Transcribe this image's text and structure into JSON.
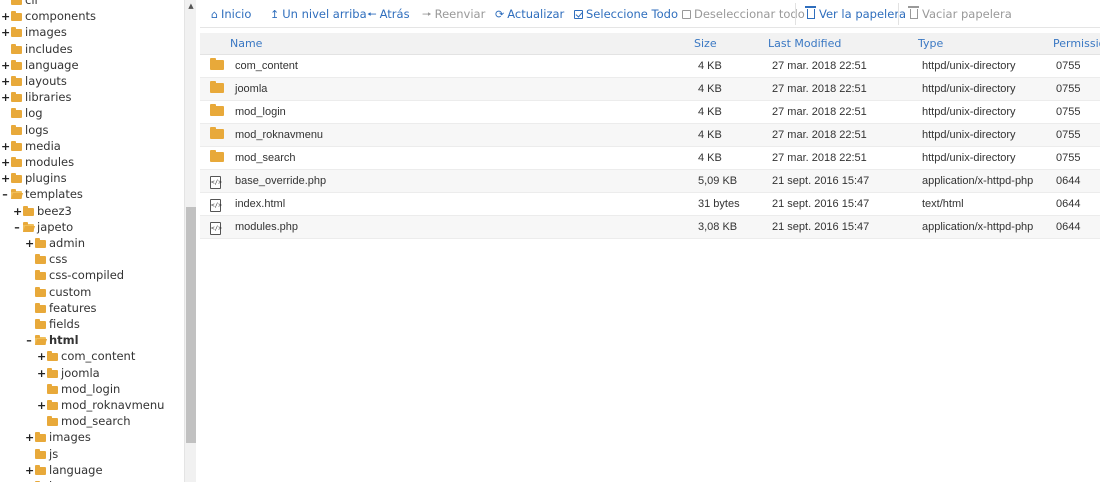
{
  "sidebar": {
    "items": [
      {
        "label": "cli",
        "toggle": "",
        "depth": 0,
        "open": false
      },
      {
        "label": "components",
        "toggle": "+",
        "depth": 0,
        "open": false
      },
      {
        "label": "images",
        "toggle": "+",
        "depth": 0,
        "open": false
      },
      {
        "label": "includes",
        "toggle": "",
        "depth": 0,
        "open": false
      },
      {
        "label": "language",
        "toggle": "+",
        "depth": 0,
        "open": false
      },
      {
        "label": "layouts",
        "toggle": "+",
        "depth": 0,
        "open": false
      },
      {
        "label": "libraries",
        "toggle": "+",
        "depth": 0,
        "open": false
      },
      {
        "label": "log",
        "toggle": "",
        "depth": 0,
        "open": false
      },
      {
        "label": "logs",
        "toggle": "",
        "depth": 0,
        "open": false
      },
      {
        "label": "media",
        "toggle": "+",
        "depth": 0,
        "open": false
      },
      {
        "label": "modules",
        "toggle": "+",
        "depth": 0,
        "open": false
      },
      {
        "label": "plugins",
        "toggle": "+",
        "depth": 0,
        "open": false
      },
      {
        "label": "templates",
        "toggle": "–",
        "depth": 0,
        "open": true
      },
      {
        "label": "beez3",
        "toggle": "+",
        "depth": 1,
        "open": false
      },
      {
        "label": "japeto",
        "toggle": "–",
        "depth": 1,
        "open": true
      },
      {
        "label": "admin",
        "toggle": "+",
        "depth": 2,
        "open": false
      },
      {
        "label": "css",
        "toggle": "",
        "depth": 2,
        "open": false
      },
      {
        "label": "css-compiled",
        "toggle": "",
        "depth": 2,
        "open": false
      },
      {
        "label": "custom",
        "toggle": "",
        "depth": 2,
        "open": false
      },
      {
        "label": "features",
        "toggle": "",
        "depth": 2,
        "open": false
      },
      {
        "label": "fields",
        "toggle": "",
        "depth": 2,
        "open": false
      },
      {
        "label": "html",
        "toggle": "–",
        "depth": 2,
        "open": true,
        "active": true
      },
      {
        "label": "com_content",
        "toggle": "+",
        "depth": 3,
        "open": false
      },
      {
        "label": "joomla",
        "toggle": "+",
        "depth": 3,
        "open": false
      },
      {
        "label": "mod_login",
        "toggle": "",
        "depth": 3,
        "open": false
      },
      {
        "label": "mod_roknavmenu",
        "toggle": "+",
        "depth": 3,
        "open": false
      },
      {
        "label": "mod_search",
        "toggle": "",
        "depth": 3,
        "open": false
      },
      {
        "label": "images",
        "toggle": "+",
        "depth": 2,
        "open": false
      },
      {
        "label": "js",
        "toggle": "",
        "depth": 2,
        "open": false
      },
      {
        "label": "language",
        "toggle": "+",
        "depth": 2,
        "open": false
      },
      {
        "label": "less",
        "toggle": "+",
        "depth": 2,
        "open": false
      }
    ]
  },
  "toolbar": {
    "home": "Inicio",
    "up": "Un nivel arriba",
    "back": "Atrás",
    "forward": "Reenviar",
    "reload": "Actualizar",
    "select_all": "Seleccione Todo",
    "deselect_all": "Deseleccionar todo",
    "view_trash": "Ver la papelera",
    "empty_trash": "Vaciar papelera"
  },
  "table": {
    "headers": {
      "name": "Name",
      "size": "Size",
      "modified": "Last Modified",
      "type": "Type",
      "permissions": "Permissions"
    },
    "rows": [
      {
        "kind": "folder",
        "name": "com_content",
        "size": "4 KB",
        "modified": "27 mar. 2018 22:51",
        "type": "httpd/unix-directory",
        "perm": "0755"
      },
      {
        "kind": "folder",
        "name": "joomla",
        "size": "4 KB",
        "modified": "27 mar. 2018 22:51",
        "type": "httpd/unix-directory",
        "perm": "0755"
      },
      {
        "kind": "folder",
        "name": "mod_login",
        "size": "4 KB",
        "modified": "27 mar. 2018 22:51",
        "type": "httpd/unix-directory",
        "perm": "0755"
      },
      {
        "kind": "folder",
        "name": "mod_roknavmenu",
        "size": "4 KB",
        "modified": "27 mar. 2018 22:51",
        "type": "httpd/unix-directory",
        "perm": "0755"
      },
      {
        "kind": "folder",
        "name": "mod_search",
        "size": "4 KB",
        "modified": "27 mar. 2018 22:51",
        "type": "httpd/unix-directory",
        "perm": "0755"
      },
      {
        "kind": "file",
        "name": "base_override.php",
        "size": "5,09 KB",
        "modified": "21 sept. 2016 15:47",
        "type": "application/x-httpd-php",
        "perm": "0644"
      },
      {
        "kind": "file",
        "name": "index.html",
        "size": "31 bytes",
        "modified": "21 sept. 2016 15:47",
        "type": "text/html",
        "perm": "0644"
      },
      {
        "kind": "file",
        "name": "modules.php",
        "size": "3,08 KB",
        "modified": "21 sept. 2016 15:47",
        "type": "application/x-httpd-php",
        "perm": "0644"
      }
    ]
  }
}
